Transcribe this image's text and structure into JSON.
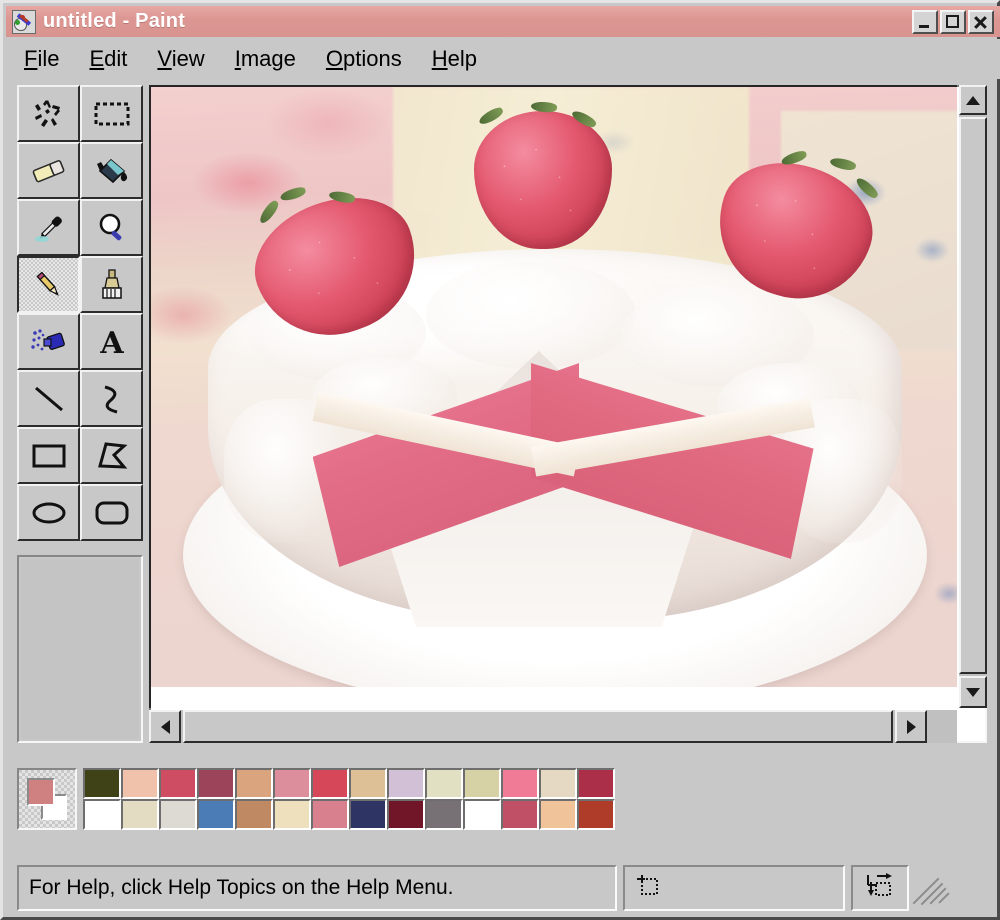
{
  "window": {
    "title": "untitled - Paint",
    "icon": "paint-palette-icon",
    "titlebar_color": "#dd9793",
    "face_color": "#c8c8c8",
    "controls": [
      {
        "name": "minimize",
        "glyph": "_"
      },
      {
        "name": "maximize",
        "glyph": "□"
      },
      {
        "name": "close",
        "glyph": "×"
      }
    ]
  },
  "menubar": {
    "items": [
      {
        "label": "File",
        "accel": "F"
      },
      {
        "label": "Edit",
        "accel": "E"
      },
      {
        "label": "View",
        "accel": "V"
      },
      {
        "label": "Image",
        "accel": "I"
      },
      {
        "label": "Options",
        "accel": "O"
      },
      {
        "label": "Help",
        "accel": "H"
      }
    ]
  },
  "toolbox": {
    "selected": "pencil",
    "tools": [
      {
        "id": "free-form-select",
        "label": "Free-Form Select"
      },
      {
        "id": "select",
        "label": "Select"
      },
      {
        "id": "eraser",
        "label": "Eraser/Color Eraser"
      },
      {
        "id": "fill",
        "label": "Fill With Color"
      },
      {
        "id": "pick-color",
        "label": "Pick Color"
      },
      {
        "id": "magnifier",
        "label": "Magnifier"
      },
      {
        "id": "pencil",
        "label": "Pencil"
      },
      {
        "id": "brush",
        "label": "Brush"
      },
      {
        "id": "airbrush",
        "label": "Airbrush"
      },
      {
        "id": "text",
        "label": "Text"
      },
      {
        "id": "line",
        "label": "Line"
      },
      {
        "id": "curve",
        "label": "Curve"
      },
      {
        "id": "rectangle",
        "label": "Rectangle"
      },
      {
        "id": "polygon",
        "label": "Polygon"
      },
      {
        "id": "ellipse",
        "label": "Ellipse"
      },
      {
        "id": "rounded-rectangle",
        "label": "Rounded Rectangle"
      }
    ]
  },
  "canvas": {
    "image_subject": "Strawberry layer cake with whipped cream frosting, a wedge cut out, on a lace doily",
    "description": "Pink sponge cake with cream filling layers, topped with three halved strawberries and white frosting, on a floral tablecloth"
  },
  "palette": {
    "foreground": "#cf8080",
    "background": "#ffffff",
    "top_row": [
      "#3f4216",
      "#f0c2ab",
      "#cf4d62",
      "#9c4459",
      "#d9a47e",
      "#dc8e9c",
      "#d6475a",
      "#ddc096",
      "#d2c0d6",
      "#e2e0c2",
      "#d7d2a6",
      "#ef7b96",
      "#e6d9c3",
      "#ab2f49"
    ],
    "bottom_row": [
      "#ffffff",
      "#e3dcc2",
      "#dcdad2",
      "#4c7cb5",
      "#bf8a63",
      "#eedfbd",
      "#d9808e",
      "#2e3463",
      "#701628",
      "#777175",
      "#ffffff",
      "#c05065",
      "#f0c39b",
      "#ae3c28"
    ]
  },
  "scrollbars": {
    "vertical": {
      "up": "▲",
      "down": "▼"
    },
    "horizontal": {
      "left": "◀",
      "right": "▶"
    }
  },
  "statusbar": {
    "help_text": "For Help, click Help Topics on the Help Menu.",
    "position_value": "",
    "size_value": "",
    "position_icon": "cursor-position-icon",
    "size_icon": "selection-size-icon"
  }
}
